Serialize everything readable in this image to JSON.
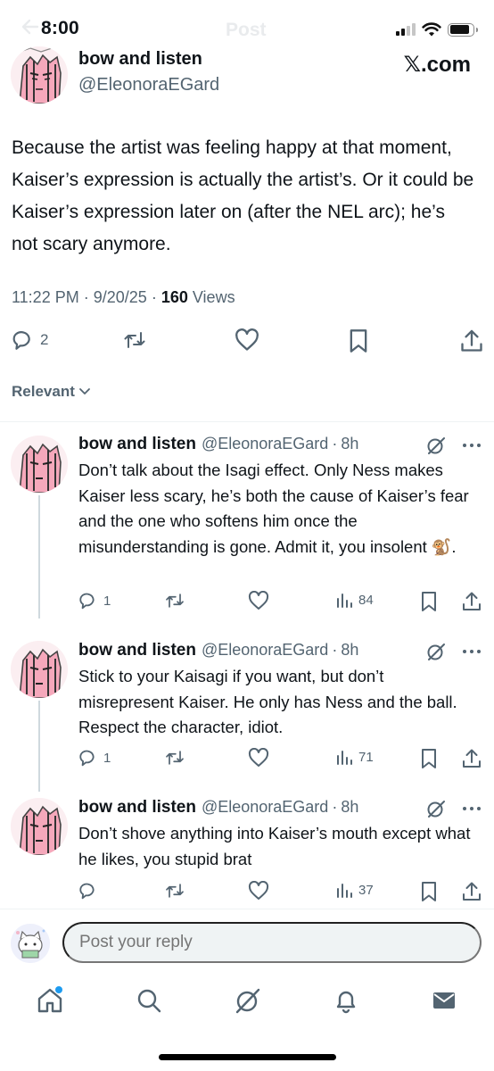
{
  "status_bar": {
    "time": "8:00"
  },
  "header": {
    "ghost_title": "Post"
  },
  "post": {
    "author": {
      "name": "bow and listen",
      "handle": "@EleonoraEGard"
    },
    "badge": "𝕏.com",
    "text": "Because the artist was feeling happy at that moment, Kaiser’s expression is actually the artist’s. Or it could be Kaiser’s expression later on (after the NEL arc); he’s not scary anymore.",
    "time": "11:22 PM",
    "date": "9/20/25",
    "views_count": "160",
    "views_label": "Views",
    "reply_count": "2"
  },
  "sort": {
    "label": "Relevant"
  },
  "replies": [
    {
      "name": "bow and listen",
      "handle": "@EleonoraEGard",
      "sep": "·",
      "age": "8h",
      "text": "Don’t talk about the Isagi effect. Only Ness makes Kaiser less scary, he’s both the cause of Kaiser’s fear and the one who softens him once the misunderstanding is gone. Admit it, you insolent",
      "emoji": "🐒",
      "text_end": ".",
      "replies": "1",
      "views": "84"
    },
    {
      "name": "bow and listen",
      "handle": "@EleonoraEGard",
      "sep": "·",
      "age": "8h",
      "text": "Stick to your Kaisagi if you want, but don’t misrepresent Kaiser. He only has Ness and the ball. Respect the character, idiot.",
      "replies": "1",
      "views": "71"
    },
    {
      "name": "bow and listen",
      "handle": "@EleonoraEGard",
      "sep": "·",
      "age": "8h",
      "text": "Don’t shove anything into Kaiser’s mouth except what he likes, you stupid brat",
      "replies": "",
      "views": "37"
    }
  ],
  "composer": {
    "placeholder": "Post your reply"
  },
  "nav": [
    "home-icon",
    "search-icon",
    "grok-icon",
    "notifications-icon",
    "messages-icon"
  ],
  "colors": {
    "text": "#0f1419",
    "muted": "#536471",
    "divider": "#eff3f4",
    "notification_dot": "#1d9bf0"
  }
}
